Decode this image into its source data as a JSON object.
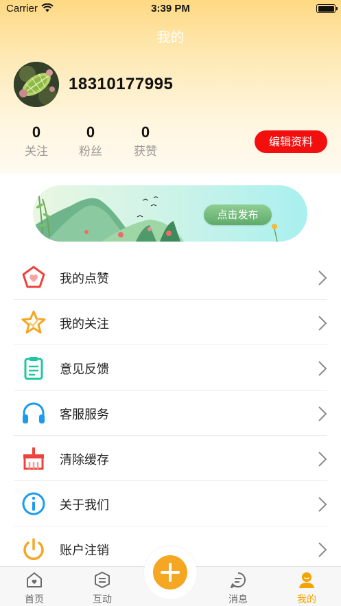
{
  "status_bar": {
    "carrier": "Carrier",
    "time": "3:39 PM"
  },
  "nav": {
    "title": "我的"
  },
  "profile": {
    "username": "18310177995"
  },
  "stats": [
    {
      "value": "0",
      "label": "关注"
    },
    {
      "value": "0",
      "label": "粉丝"
    },
    {
      "value": "0",
      "label": "获赞"
    }
  ],
  "edit_profile_label": "编辑资料",
  "banner": {
    "button_label": "点击发布"
  },
  "menu": [
    {
      "label": "我的点赞",
      "icon": "heart-pentagon-icon",
      "color": "#f0423c"
    },
    {
      "label": "我的关注",
      "icon": "star-icon",
      "color": "#f5a623"
    },
    {
      "label": "意见反馈",
      "icon": "clipboard-icon",
      "color": "#1fc7a0"
    },
    {
      "label": "客服服务",
      "icon": "headphones-icon",
      "color": "#1a9bf0"
    },
    {
      "label": "清除缓存",
      "icon": "broom-icon",
      "color": "#f0423c"
    },
    {
      "label": "关于我们",
      "icon": "info-icon",
      "color": "#1a9bf0"
    },
    {
      "label": "账户注销",
      "icon": "power-icon",
      "color": "#f5a623"
    }
  ],
  "tabbar": {
    "tabs": [
      {
        "label": "首页",
        "icon": "home-icon",
        "active": false
      },
      {
        "label": "互动",
        "icon": "interaction-icon",
        "active": false
      },
      {
        "label": "消息",
        "icon": "message-icon",
        "active": false
      },
      {
        "label": "我的",
        "icon": "profile-icon",
        "active": true
      }
    ],
    "center_icon": "plus-icon"
  },
  "colors": {
    "accent": "#f5a623",
    "edit_button": "#f40f0f",
    "publish_button": "#5eaa6a"
  }
}
